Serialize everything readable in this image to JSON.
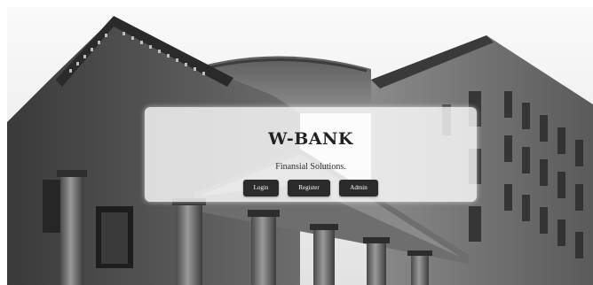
{
  "brand": {
    "title": "W-BANK",
    "tagline": "Finansial Solutions."
  },
  "actions": {
    "login_label": "Login",
    "register_label": "Register",
    "admin_label": "Admin"
  },
  "hero": {
    "image": "bank-building-photo",
    "tone": "grayscale"
  },
  "colors": {
    "button_bg": "#2b2b2b",
    "button_text": "#ffffff",
    "card_bg": "rgba(255,255,255,0.80)",
    "title_text": "#222222"
  }
}
